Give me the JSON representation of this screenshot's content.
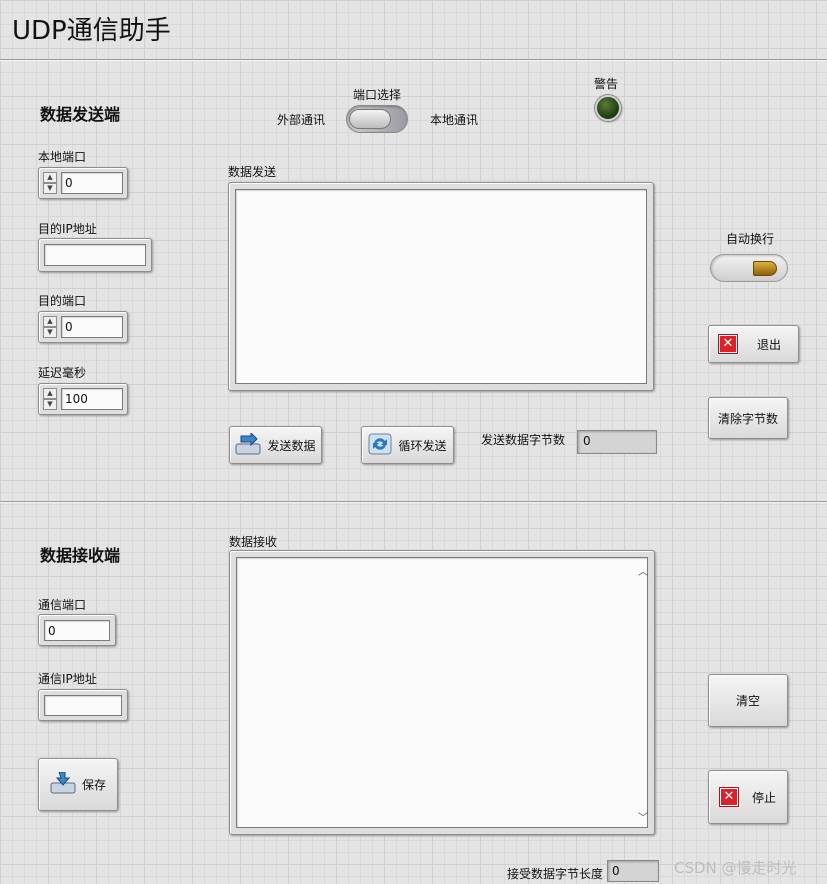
{
  "window": {
    "title": "UDP通信助手"
  },
  "send_section": {
    "title": "数据发送端",
    "local_port": {
      "label": "本地端口",
      "value": "0"
    },
    "dest_ip": {
      "label": "目的IP地址",
      "value": ""
    },
    "dest_port": {
      "label": "目的端口",
      "value": "0"
    },
    "delay_ms": {
      "label": "延迟毫秒",
      "value": "100"
    },
    "port_select": {
      "label": "端口选择",
      "left": "外部通讯",
      "right": "本地通讯",
      "selected": "外部通讯"
    },
    "warning": {
      "label": "警告"
    },
    "data_send": {
      "label": "数据发送",
      "value": ""
    },
    "send_button": "发送数据",
    "loop_button": "循环发送",
    "byte_count": {
      "label": "发送数据字节数",
      "value": "0"
    },
    "auto_newline": {
      "label": "自动换行"
    },
    "exit_button": "退出",
    "clear_bytes_button": "清除字节数"
  },
  "receive_section": {
    "title": "数据接收端",
    "comm_port": {
      "label": "通信端口",
      "value": "0"
    },
    "comm_ip": {
      "label": "通信IP地址",
      "value": ""
    },
    "save_button": "保存",
    "data_receive": {
      "label": "数据接收",
      "value": ""
    },
    "clear_button": "清空",
    "stop_button": "停止",
    "recv_length": {
      "label": "接受数据字节长度",
      "value": "0"
    }
  },
  "watermark": "CSDN @慢走时光",
  "colors": {
    "stop_icon": "#d8232a",
    "led_off": "#1a3a0a",
    "auto_newline_light": "#c89a20"
  }
}
